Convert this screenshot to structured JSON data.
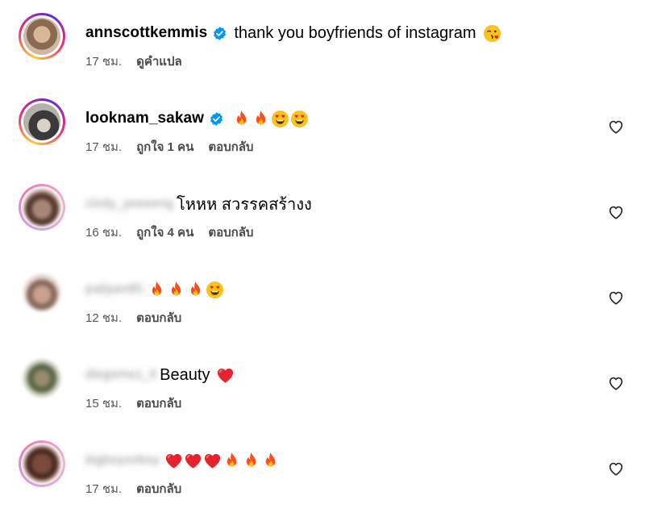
{
  "comments": [
    {
      "username": "annscottkemmis",
      "verified": true,
      "text": "thank you boyfriends of instagram",
      "emojis": [
        "kiss-emoji"
      ],
      "time": "17 ชม.",
      "actions": [
        "ดูคำแปล"
      ],
      "has_like": false
    },
    {
      "username": "looknam_sakaw",
      "verified": true,
      "text": "",
      "emojis": [
        "fire-emoji",
        "fire-emoji",
        "heart-eyes-emoji",
        "heart-eyes-emoji"
      ],
      "time": "17 ชม.",
      "actions": [
        "ถูกใจ 1 คน",
        "ตอบกลับ"
      ],
      "has_like": true
    },
    {
      "username": "cindy_yeeeeng",
      "username_blurred": true,
      "text": "โหหห สวรรคสร้างง",
      "emojis": [],
      "time": "16 ชม.",
      "actions": [
        "ถูกใจ 4 คน",
        "ตอบกลับ"
      ],
      "has_like": true
    },
    {
      "username": "patipan85",
      "username_blurred": true,
      "text": "",
      "emojis": [
        "fire-emoji",
        "fire-emoji",
        "fire-emoji",
        "heart-eyes-emoji"
      ],
      "time": "12 ชม.",
      "actions": [
        "ตอบกลับ"
      ],
      "has_like": true
    },
    {
      "username": "diegomez_9",
      "username_blurred": true,
      "text": "Beauty",
      "emojis": [
        "red-heart-emoji"
      ],
      "time": "15 ชม.",
      "actions": [
        "ตอบกลับ"
      ],
      "has_like": true
    },
    {
      "username": "bigboyonboy",
      "username_blurred": true,
      "text": "",
      "emojis": [
        "red-heart-emoji",
        "red-heart-emoji",
        "red-heart-emoji",
        "fire-emoji",
        "fire-emoji",
        "fire-emoji"
      ],
      "time": "17 ชม.",
      "actions": [
        "ตอบกลับ"
      ],
      "has_like": true
    }
  ],
  "colors": {
    "verified_badge": "#0095f6",
    "story_ring": "#ee2a7b",
    "heart": "#e8212f",
    "meta_text": "#4a4a4a"
  }
}
